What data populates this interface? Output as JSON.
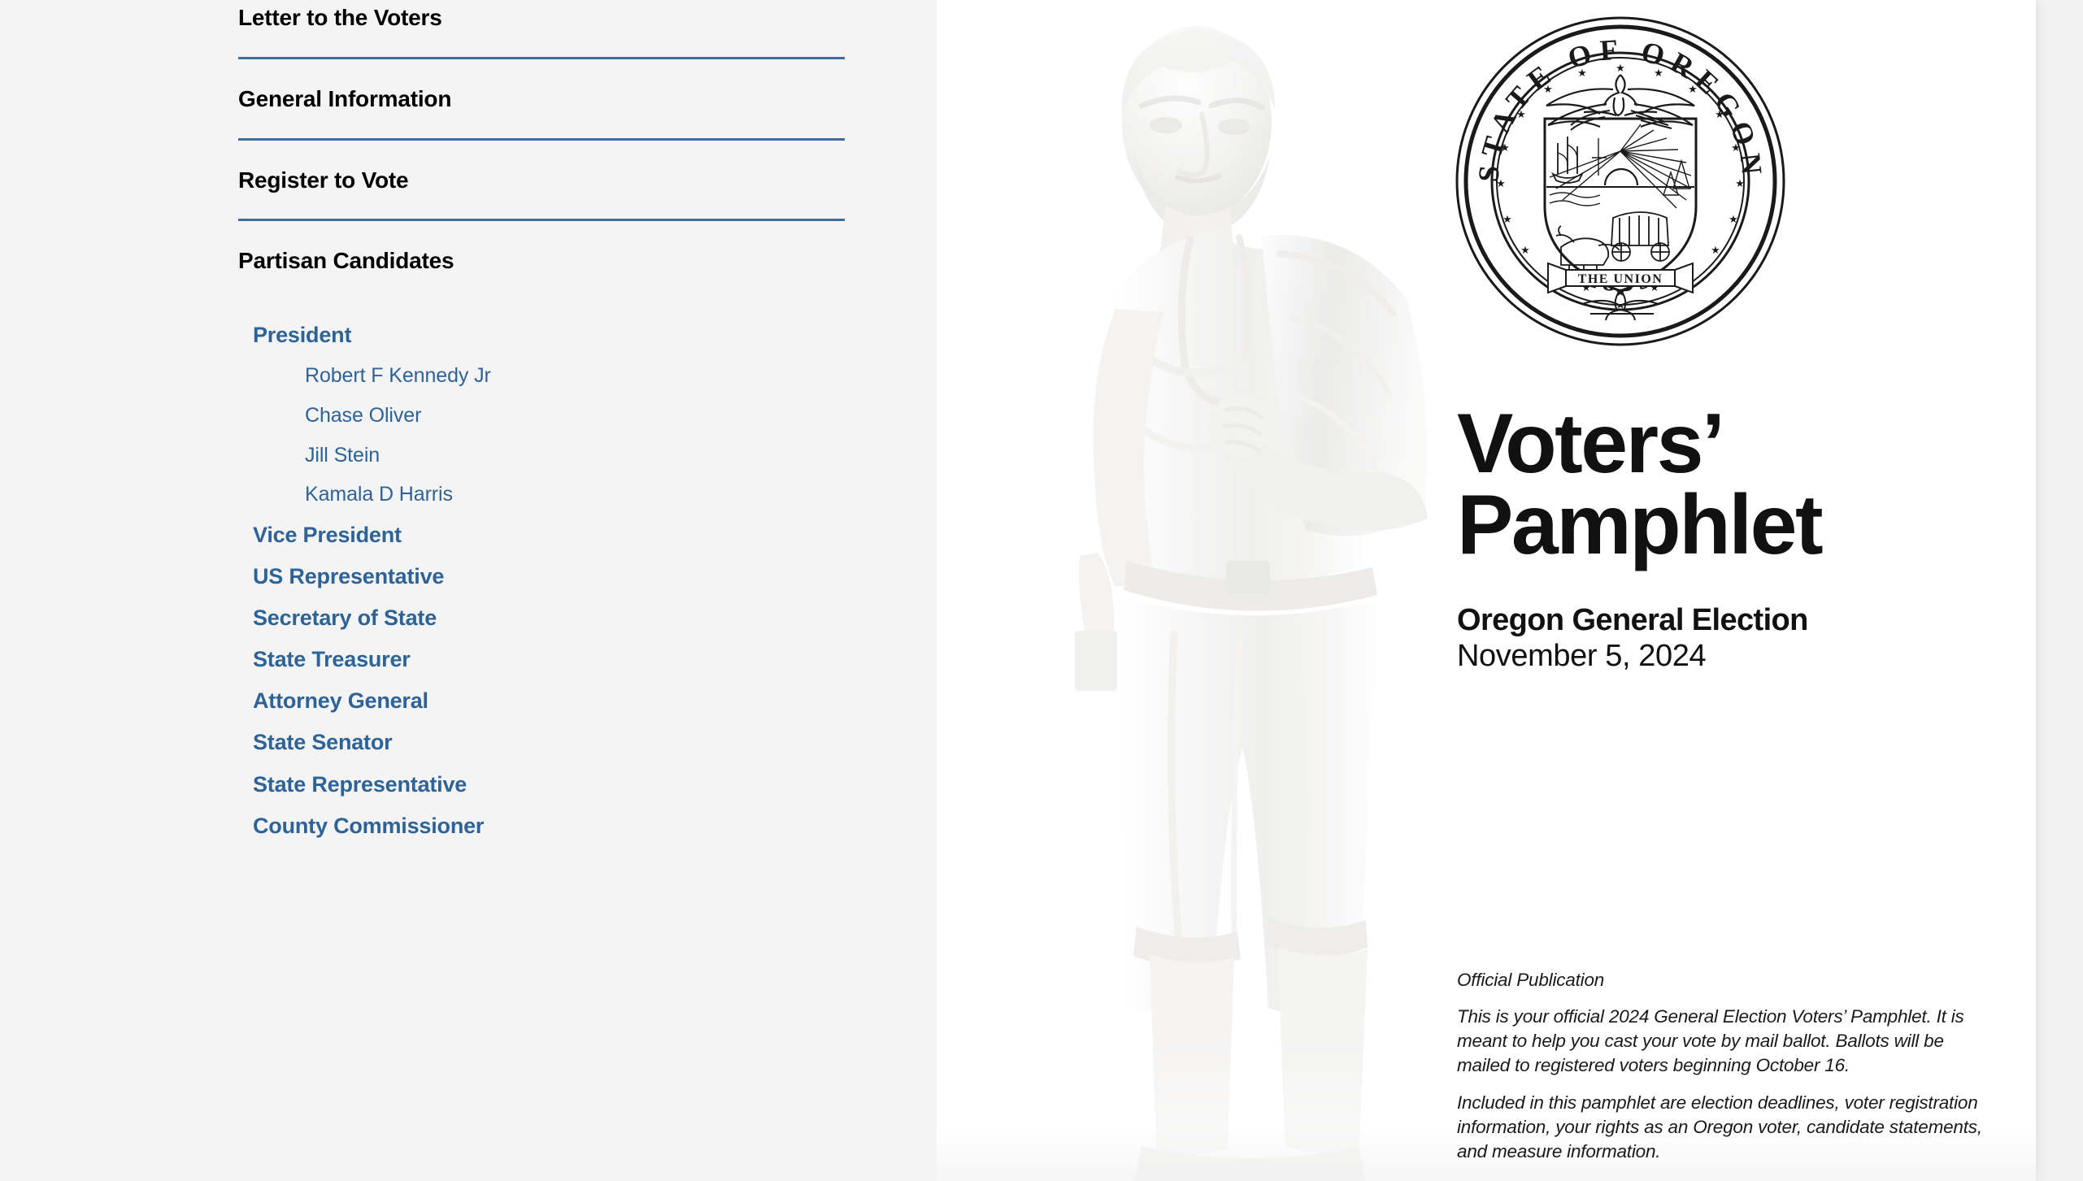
{
  "colors": {
    "sidebar_bg": "#f4f4f4",
    "page_bg": "#ffffff",
    "app_bg": "#f2f2f2",
    "link_blue": "#2e6398",
    "rule_blue": "#3d6e9e",
    "rule_light": "#c8d3e0",
    "heading_black": "#000000"
  },
  "toc": {
    "major_sections": [
      {
        "label": "Letter to the Voters"
      },
      {
        "label": "General Information"
      },
      {
        "label": "Register to Vote"
      },
      {
        "label": "Partisan Candidates"
      }
    ],
    "offices": [
      {
        "label": "President",
        "candidates": [
          "Robert F Kennedy Jr",
          "Chase Oliver",
          "Jill Stein",
          "Kamala D Harris"
        ]
      },
      {
        "label": "Vice President",
        "candidates": []
      },
      {
        "label": "US Representative",
        "candidates": []
      },
      {
        "label": "Secretary of State",
        "candidates": []
      },
      {
        "label": "State Treasurer",
        "candidates": []
      },
      {
        "label": "Attorney General",
        "candidates": []
      },
      {
        "label": "State Senator",
        "candidates": []
      },
      {
        "label": "State Representative",
        "candidates": []
      },
      {
        "label": "County Commissioner",
        "candidates": []
      }
    ]
  },
  "cover": {
    "seal": {
      "icon": "state-seal-icon",
      "top_text": "STATE OF",
      "arc_text": "OREGON",
      "year": "1859",
      "banner": "THE UNION"
    },
    "title_line1": "Voters’",
    "title_line2": "Pamphlet",
    "election_name": "Oregon General Election",
    "election_date": "November 5, 2024",
    "official": {
      "heading": "Official Publication",
      "paragraph1": "This is your official 2024 General Election Voters’ Pamphlet. It is meant to help you cast your vote by mail ballot. Ballots will be mailed to registered voters beginning October 16.",
      "paragraph2": "Included in this pamphlet are election deadlines, voter registration information, your rights as an Oregon voter, candidate statements, and measure information."
    },
    "artwork": {
      "icon": "oregon-pioneer-statue-image",
      "caption": ""
    }
  }
}
